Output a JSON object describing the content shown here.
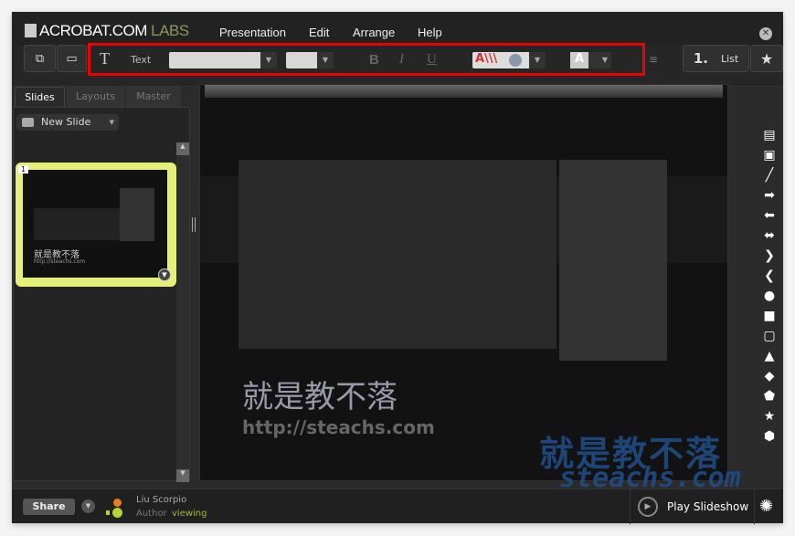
{
  "app": {
    "brand": "ACROBAT.COM",
    "brand_suffix": "LABS"
  },
  "menu": [
    "Presentation",
    "Edit",
    "Arrange",
    "Help"
  ],
  "toolbar": {
    "text_label": "Text",
    "bold": "B",
    "italic": "I",
    "underline": "U",
    "list_number": "1.",
    "list_label": "List"
  },
  "sidebar": {
    "tabs": [
      "Slides",
      "Layouts",
      "Master"
    ],
    "new_slide": "New Slide",
    "slides": [
      {
        "number": "1",
        "title": "就是教不落",
        "url": "http://steachs.com"
      }
    ]
  },
  "slide": {
    "title": "就是教不落",
    "subtitle": "http://steachs.com"
  },
  "footer": {
    "share": "Share",
    "user_name": "Liu Scorpio",
    "user_role": "Author",
    "user_status": "viewing",
    "play": "Play Slideshow"
  },
  "watermark": {
    "line1": "就是教不落",
    "line2": "steachs.com"
  }
}
